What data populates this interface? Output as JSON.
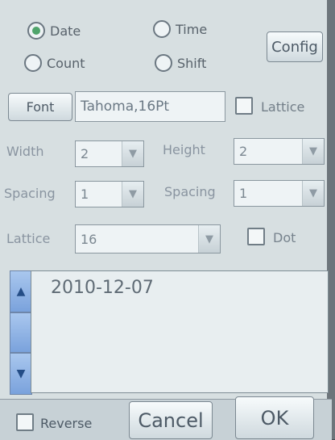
{
  "options": {
    "date": {
      "label": "Date",
      "checked": true
    },
    "time": {
      "label": "Time",
      "checked": false
    },
    "count": {
      "label": "Count",
      "checked": false
    },
    "shift": {
      "label": "Shift",
      "checked": false
    }
  },
  "config_label": "Config",
  "font": {
    "button_label": "Font",
    "value": "Tahoma,16Pt",
    "lattice_label": "Lattice",
    "lattice_checked": false
  },
  "settings": {
    "width_label": "Width",
    "width_value": "2",
    "height_label": "Height",
    "height_value": "2",
    "spacing_left_label": "Spacing",
    "spacing_left_value": "1",
    "spacing_right_label": "Spacing",
    "spacing_right_value": "1",
    "lattice_label": "Lattice",
    "lattice_value": "16",
    "dot_label": "Dot",
    "dot_checked": false
  },
  "editor": {
    "text": "2010-12-07"
  },
  "bottom": {
    "reverse_label": "Reverse",
    "reverse_checked": false,
    "cancel_label": "Cancel",
    "ok_label": "OK"
  },
  "icons": {
    "up": "▲",
    "down": "▼",
    "dropdown": "▼"
  }
}
